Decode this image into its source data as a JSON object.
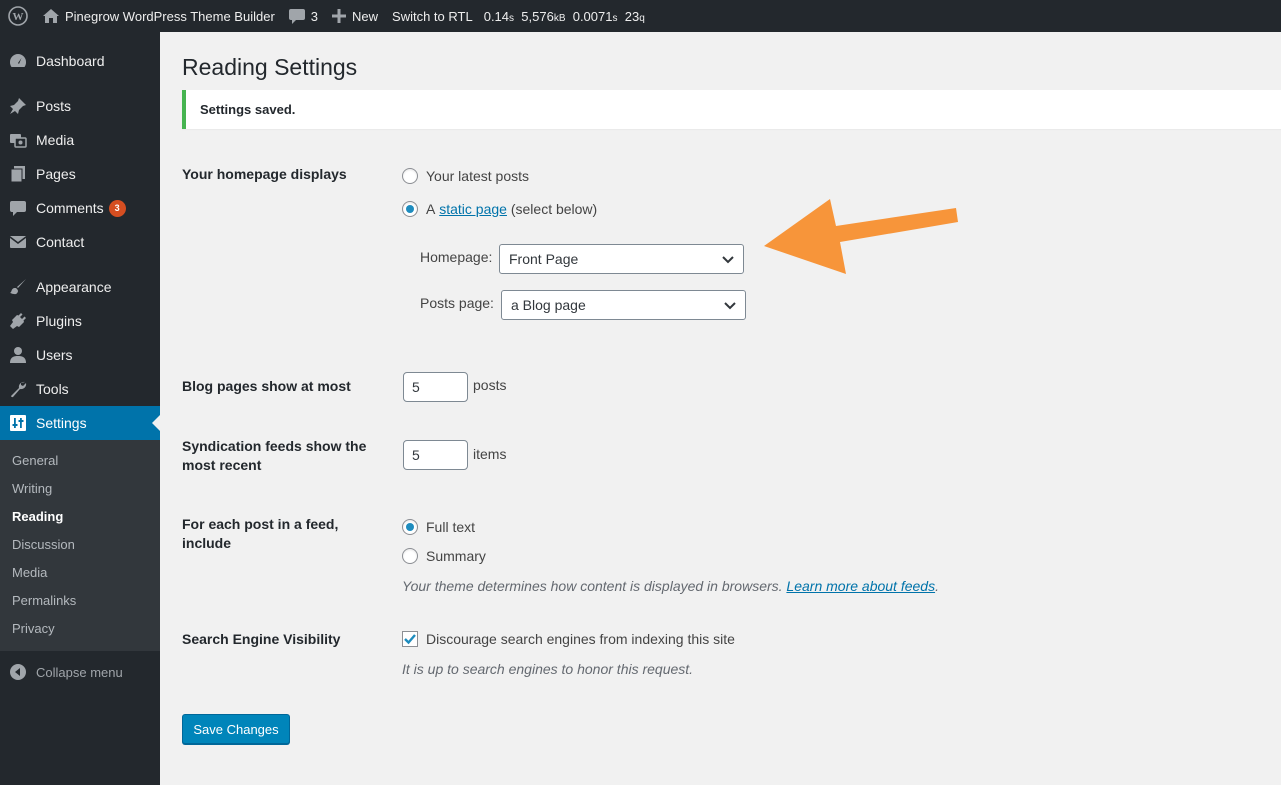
{
  "adminbar": {
    "site_name": "Pinegrow WordPress Theme Builder",
    "comments_count": "3",
    "new_label": "New",
    "rtl_label": "Switch to RTL",
    "stat_time": "0.14",
    "stat_time_unit": "s",
    "stat_memory": "5,576",
    "stat_memory_unit": "kB",
    "stat_query_time": "0.0071",
    "stat_query_time_unit": "s",
    "stat_queries": "23",
    "stat_queries_unit": "q"
  },
  "sidebar": {
    "items": [
      {
        "label": "Dashboard",
        "icon": "dashboard-icon"
      },
      {
        "label": "Posts",
        "icon": "pin-icon"
      },
      {
        "label": "Media",
        "icon": "media-icon"
      },
      {
        "label": "Pages",
        "icon": "pages-icon"
      },
      {
        "label": "Comments",
        "icon": "comment-icon",
        "badge": "3"
      },
      {
        "label": "Contact",
        "icon": "mail-icon"
      },
      {
        "label": "Appearance",
        "icon": "brush-icon"
      },
      {
        "label": "Plugins",
        "icon": "plug-icon"
      },
      {
        "label": "Users",
        "icon": "user-icon"
      },
      {
        "label": "Tools",
        "icon": "wrench-icon"
      },
      {
        "label": "Settings",
        "icon": "settings-icon"
      }
    ],
    "submenu": [
      "General",
      "Writing",
      "Reading",
      "Discussion",
      "Media",
      "Permalinks",
      "Privacy"
    ],
    "collapse_label": "Collapse menu"
  },
  "page": {
    "title": "Reading Settings",
    "notice": "Settings saved.",
    "homepage": {
      "label": "Your homepage displays",
      "option_latest": "Your latest posts",
      "option_static_pre": "A",
      "option_static_link": "static page",
      "option_static_post": "(select below)",
      "homepage_label": "Homepage:",
      "homepage_value": "Front Page",
      "posts_page_label": "Posts page:",
      "posts_page_value": "a Blog page"
    },
    "blog_pages": {
      "label": "Blog pages show at most",
      "value": "5",
      "unit": "posts"
    },
    "syndication": {
      "label_line1": "Syndication feeds show the",
      "label_line2": "most recent",
      "value": "5",
      "unit": "items"
    },
    "feed": {
      "label_line1": "For each post in a feed,",
      "label_line2": "include",
      "option_full": "Full text",
      "option_summary": "Summary",
      "desc_pre": "Your theme determines how content is displayed in browsers.",
      "desc_link": "Learn more about feeds",
      "desc_post": "."
    },
    "visibility": {
      "label": "Search Engine Visibility",
      "checkbox_label": "Discourage search engines from indexing this site",
      "desc": "It is up to search engines to honor this request."
    },
    "save_button": "Save Changes"
  },
  "colors": {
    "accent": "#0073aa",
    "success": "#46b450",
    "annotation_arrow": "#f7953a",
    "badge": "#d54e21"
  }
}
